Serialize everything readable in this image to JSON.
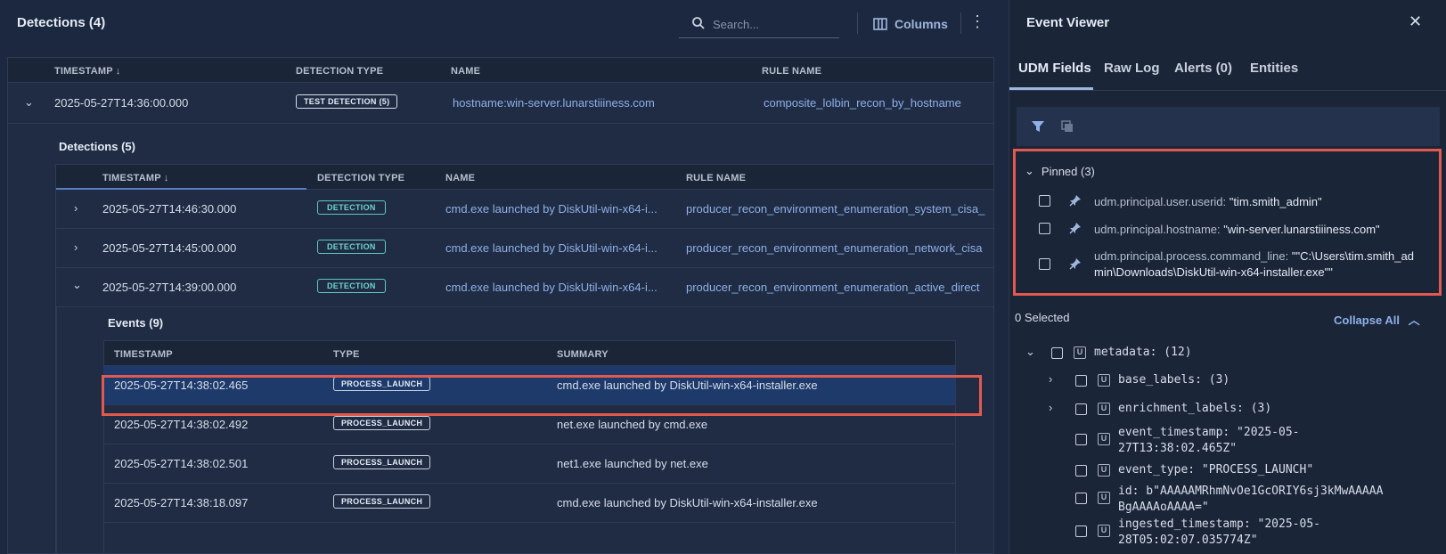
{
  "left": {
    "title": "Detections (4)",
    "search_placeholder": "Search...",
    "columns_label": "Columns",
    "more_label": "⋮",
    "outer_headers": {
      "timestamp": "TIMESTAMP ↓",
      "detection_type": "DETECTION TYPE",
      "name": "NAME",
      "rule_name": "RULE NAME"
    },
    "outer_row": {
      "timestamp": "2025-05-27T14:36:00.000",
      "type": "TEST DETECTION (5)",
      "name": "hostname:win-server.lunarstiiiness.com",
      "rule": "composite_lolbin_recon_by_hostname"
    },
    "sub_title": "Detections (5)",
    "inner_headers": {
      "timestamp": "TIMESTAMP ↓",
      "detection_type": "DETECTION TYPE",
      "name": "NAME",
      "rule_name": "RULE NAME"
    },
    "inner_rows": [
      {
        "timestamp": "2025-05-27T14:46:30.000",
        "type": "DETECTION",
        "name": "cmd.exe launched by DiskUtil-win-x64-i...",
        "rule": "producer_recon_environment_enumeration_system_cisa_"
      },
      {
        "timestamp": "2025-05-27T14:45:00.000",
        "type": "DETECTION",
        "name": "cmd.exe launched by DiskUtil-win-x64-i...",
        "rule": "producer_recon_environment_enumeration_network_cisa"
      },
      {
        "timestamp": "2025-05-27T14:39:00.000",
        "type": "DETECTION",
        "name": "cmd.exe launched by DiskUtil-win-x64-i...",
        "rule": "producer_recon_environment_enumeration_active_direct"
      }
    ],
    "events_title": "Events (9)",
    "events_headers": {
      "timestamp": "TIMESTAMP",
      "type": "TYPE",
      "summary": "SUMMARY"
    },
    "events": [
      {
        "timestamp": "2025-05-27T14:38:02.465",
        "type": "PROCESS_LAUNCH",
        "summary": "cmd.exe launched by DiskUtil-win-x64-installer.exe"
      },
      {
        "timestamp": "2025-05-27T14:38:02.492",
        "type": "PROCESS_LAUNCH",
        "summary": "net.exe launched by cmd.exe"
      },
      {
        "timestamp": "2025-05-27T14:38:02.501",
        "type": "PROCESS_LAUNCH",
        "summary": "net1.exe launched by net.exe"
      },
      {
        "timestamp": "2025-05-27T14:38:18.097",
        "type": "PROCESS_LAUNCH",
        "summary": "cmd.exe launched by DiskUtil-win-x64-installer.exe"
      }
    ]
  },
  "right": {
    "title": "Event Viewer",
    "close_label": "✕",
    "tabs": [
      "UDM Fields",
      "Raw Log",
      "Alerts (0)",
      "Entities"
    ],
    "pinned_label": "Pinned (3)",
    "pinned": [
      {
        "key": "udm.principal.user.userid:",
        "value": "\"tim.smith_admin\""
      },
      {
        "key": "udm.principal.hostname:",
        "value": "\"win-server.lunarstiiiness.com\""
      },
      {
        "key": "udm.principal.process.command_line:",
        "value": "\"\"C:\\Users\\tim.smith_ad",
        "value2": "min\\Downloads\\DiskUtil-win-x64-installer.exe\"\""
      }
    ],
    "selected_count": "0 Selected",
    "collapse_all": "Collapse All",
    "tree": {
      "metadata": "metadata: (12)",
      "base_labels": "base_labels: (3)",
      "enrichment_labels": "enrichment_labels: (3)",
      "event_timestamp_1": "event_timestamp: \"2025-05-",
      "event_timestamp_2": "27T13:38:02.465Z\"",
      "event_type": "event_type: \"PROCESS_LAUNCH\"",
      "id_1": "id: b\"AAAAAMRhmNvOe1GcORIY6sj3kMwAAAAA",
      "id_2": "BgAAAAoAAAA=\"",
      "ingested_1": "ingested_timestamp: \"2025-05-",
      "ingested_2": "28T05:02:07.035774Z\""
    }
  },
  "colors": {
    "accent": "#9fb6dc",
    "highlight": "#e25a4f",
    "selected_row": "#1d3a6a",
    "teal": "#6fd3ce",
    "link": "#8fb0e8"
  }
}
